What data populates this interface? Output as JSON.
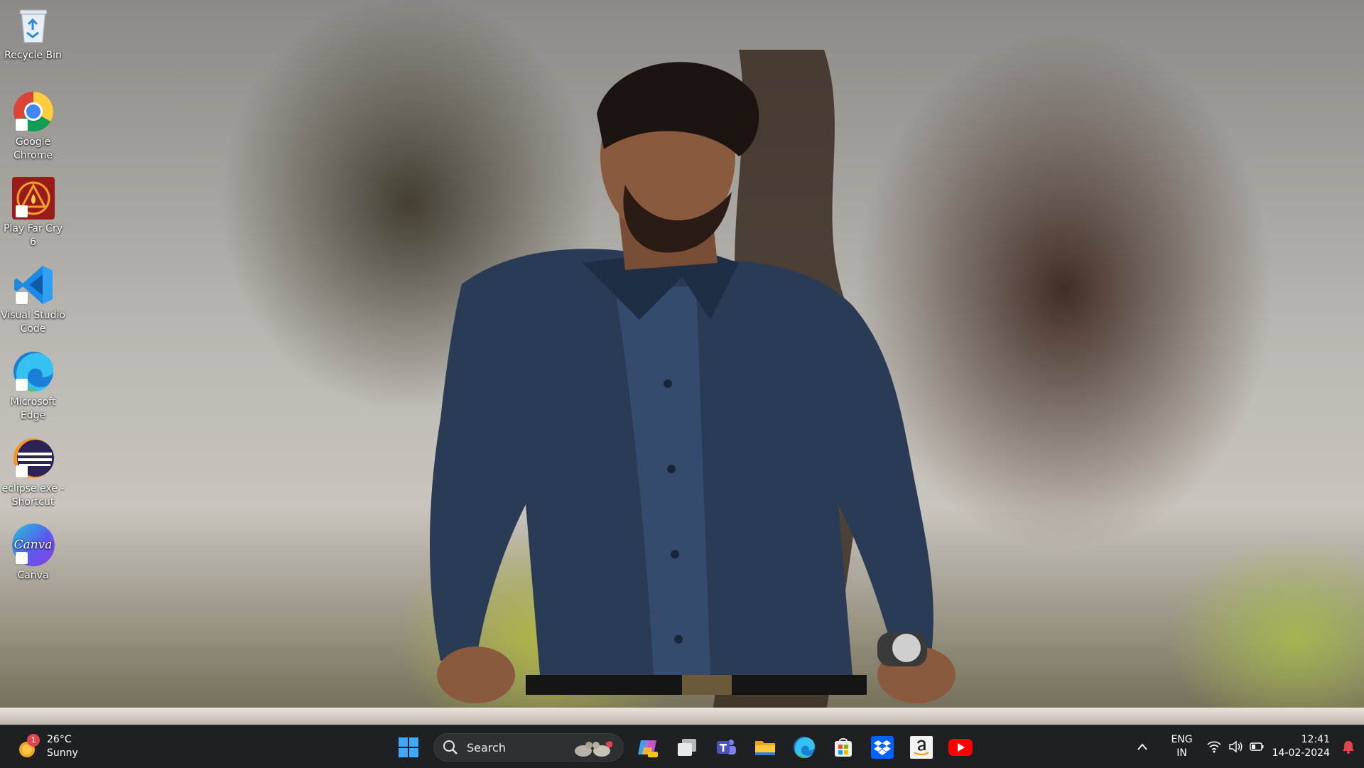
{
  "desktop": {
    "icons": [
      {
        "label": "Recycle Bin",
        "icon": "recycle-bin-icon"
      },
      {
        "label": "Google Chrome",
        "icon": "chrome-icon"
      },
      {
        "label": "Play Far Cry 6",
        "icon": "far-cry-6-icon"
      },
      {
        "label": "Visual Studio Code",
        "icon": "vscode-icon"
      },
      {
        "label": "Microsoft Edge",
        "icon": "edge-icon"
      },
      {
        "label": "eclipse.exe - Shortcut",
        "icon": "eclipse-icon"
      },
      {
        "label": "Canva",
        "icon": "canva-icon",
        "glyph": "Canva"
      }
    ]
  },
  "taskbar": {
    "weather": {
      "temp": "26°C",
      "condition": "Sunny",
      "badge": "1",
      "icon": "sun-icon"
    },
    "search": {
      "label": "Search",
      "icon": "search-icon"
    },
    "pinned_apps": [
      {
        "name": "start",
        "icon": "windows-start-icon"
      },
      {
        "name": "copilot",
        "icon": "copilot-icon"
      },
      {
        "name": "task-view",
        "icon": "task-view-icon"
      },
      {
        "name": "teams",
        "icon": "teams-icon"
      },
      {
        "name": "file-explorer",
        "icon": "folder-icon"
      },
      {
        "name": "edge",
        "icon": "edge-icon"
      },
      {
        "name": "microsoft-store",
        "icon": "store-icon"
      },
      {
        "name": "dropbox",
        "icon": "dropbox-icon"
      },
      {
        "name": "amazon",
        "icon": "amazon-icon"
      },
      {
        "name": "youtube",
        "icon": "youtube-icon"
      }
    ],
    "tray": {
      "lang_line1": "ENG",
      "lang_line2": "IN",
      "time": "12:41",
      "date": "14-02-2024"
    }
  },
  "colors": {
    "taskbar_bg": "#1f2023",
    "accent_blue": "#2b9af3",
    "notification_red": "#e0464e"
  }
}
